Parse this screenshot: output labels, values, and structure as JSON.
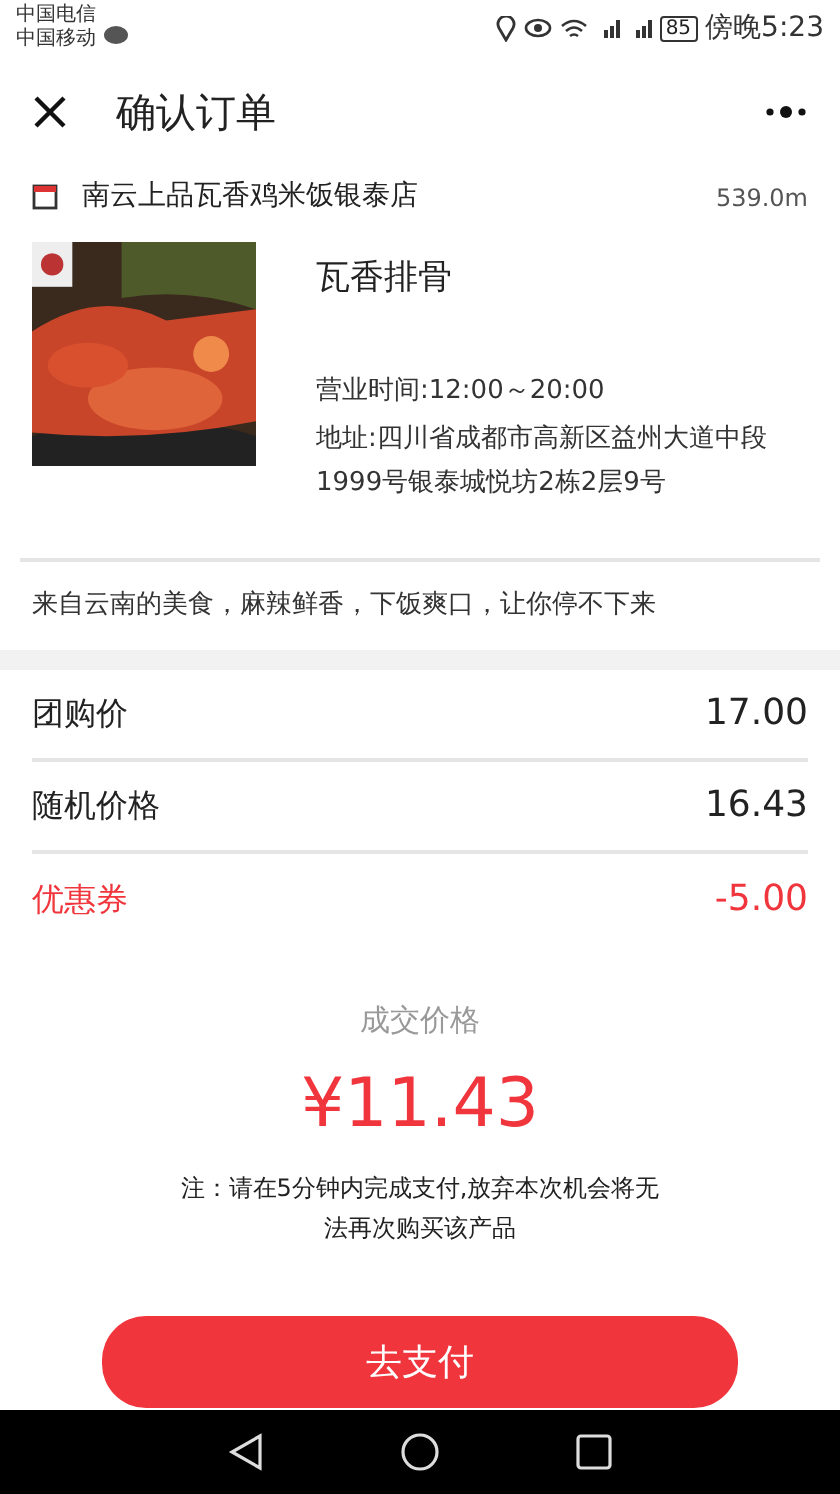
{
  "status_bar": {
    "carriers": [
      "中国电信",
      "中国移动"
    ],
    "battery": "85",
    "time": "傍晚5:23"
  },
  "header": {
    "title": "确认订单"
  },
  "store": {
    "name": "南云上品瓦香鸡米饭银泰店",
    "distance": "539.0m"
  },
  "product": {
    "name": "瓦香排骨",
    "hours": "营业时间:12:00～20:00",
    "address": "地址:四川省成都市高新区益州大道中段1999号银泰城悦坊2栋2层9号"
  },
  "description": "来自云南的美食，麻辣鲜香，下饭爽口，让你停不下来",
  "price_rows": [
    {
      "label": "团购价",
      "value": "17.00",
      "highlight": false
    },
    {
      "label": "随机价格",
      "value": "16.43",
      "highlight": false
    },
    {
      "label": "优惠券",
      "value": "-5.00",
      "highlight": true
    }
  ],
  "final": {
    "label": "成交价格",
    "price": "¥11.43",
    "note": "注：请在5分钟内完成支付,放弃本次机会将无法再次购买该产品"
  },
  "pay_button": "去支付"
}
